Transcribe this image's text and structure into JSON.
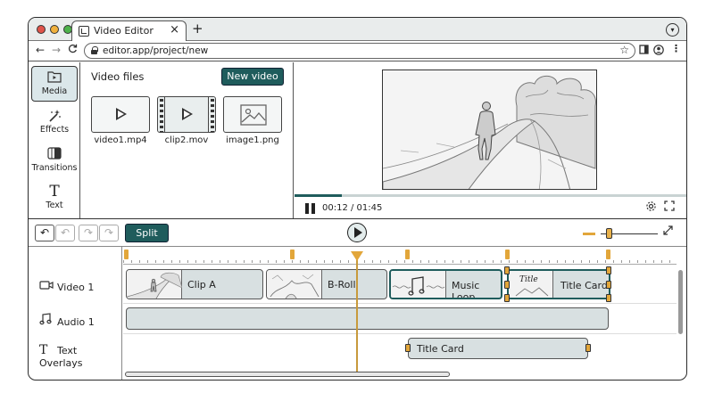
{
  "browser": {
    "tab_title": "Video Editor",
    "tab_close": "×",
    "new_tab": "+",
    "url": "editor.app/project/new",
    "nav": {
      "back": "←",
      "forward": "→",
      "reload": "C"
    }
  },
  "sidebar": {
    "items": [
      {
        "label": "Media",
        "icon": "media-folder-icon",
        "active": true
      },
      {
        "label": "Effects",
        "icon": "magic-wand-icon",
        "active": false
      },
      {
        "label": "Transitions",
        "icon": "transitions-icon",
        "active": false
      },
      {
        "label": "Text",
        "icon": "text-icon",
        "active": false
      }
    ]
  },
  "media_panel": {
    "title": "Video files",
    "new_button": "New video",
    "files": [
      {
        "name": "video1.mp4",
        "kind": "video"
      },
      {
        "name": "clip2.mov",
        "kind": "film"
      },
      {
        "name": "image1.png",
        "kind": "image"
      }
    ]
  },
  "preview": {
    "timecode": "00:12 / 01:45",
    "progress": 0.12
  },
  "toolbar": {
    "undo": "↶",
    "redo": "↷",
    "split_label": "Split",
    "zoom_level": 0.15
  },
  "timeline": {
    "tracks": [
      {
        "label": "Video 1",
        "icon": "video-camera-icon"
      },
      {
        "label": "Audio 1",
        "icon": "music-note-icon"
      },
      {
        "label": "Text Overlays",
        "icon": "text-icon"
      }
    ],
    "video_clips": [
      {
        "name": "Clip A",
        "selected": false
      },
      {
        "name": "B-Roll",
        "selected": false
      },
      {
        "name": "Music Loop",
        "selected": true
      },
      {
        "name": "Title Card",
        "selected": true,
        "thumb_text": "Title"
      }
    ],
    "text_clip": {
      "name": "Title Card"
    }
  },
  "colors": {
    "accent": "#1f5c5c",
    "marker": "#e2a63a",
    "clip": "#d8e0e1",
    "active_nav": "#dbe7ea"
  }
}
